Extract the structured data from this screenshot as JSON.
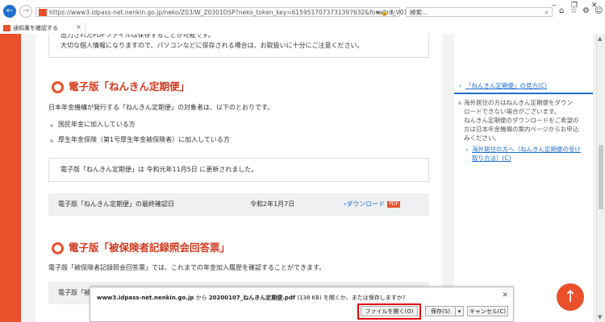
{
  "browser": {
    "url": "https://www3.idpass-net.nenkin.go.jp/neko/Z03/W_Z0301DSP?neko_token_key=6159517073731397632&forward_V0101",
    "url_host": "www3.idpass-net.nenkin.go.jp",
    "search_placeholder": "検索...",
    "tab_label": "通知書を確認する",
    "tab_close": "×"
  },
  "main": {
    "intro_line1": "出力されたPDFファイルは保存することが可能です。",
    "intro_line2": "大切な個人情報になりますので、パソコンなどに保存される場合は、お取扱いに十分にご注意ください。",
    "section1": {
      "title": "電子版「ねんきん定期便」",
      "desc": "日本年金機構が発行する「ねんきん定期便」の対象者は、以下のとおりです。",
      "bullets": [
        "国民年金に加入している方",
        "厚生年金保険（第1号厚生年金被保険者）に加入している方"
      ],
      "notice": "電子版「ねんきん定期便」は 令和元年11月5日 に更新されました。",
      "row_label": "電子版「ねんきん定期便」の最終確認日",
      "row_date": "令和2年1月7日",
      "download_label": "ダウンロード",
      "pdf_badge": "PDF"
    },
    "section2": {
      "title": "電子版「被保険者記録照会回答票」",
      "desc": "電子版「被保険者記録照会回答票」では、これまでの年金加入履歴を確認することができます。",
      "row_label": "電子版「被"
    }
  },
  "sidebar": {
    "link1": "「ねんきん定期便」の見方",
    "link1_suffix": "(C)",
    "note_lines": [
      "海外居住の方はねんきん定期便をダウン",
      "ロードできない場合がございます。",
      "ねんきん定期便のダウンロードをご希望の",
      "方は日本年金機構の案内ページからお申込",
      "みください。"
    ],
    "link2_line1": "海外居住の方へ（ねんきん定期便の受け",
    "link2_line2": "取り方法）",
    "link2_suffix": "(C)"
  },
  "download_bar": {
    "host": "www3.idpass-net.nenkin.go.jp",
    "message_mid": " から ",
    "file": "20200107_ねんきん定期便.pdf",
    "message_end": " (138 KB) を開くか、または保存しますか?",
    "open_label": "ファイルを開く(O)",
    "save_label": "保存(S)",
    "cancel_label": "キャンセル(C)"
  },
  "colors": {
    "accent": "#e9502b",
    "link": "#1f6fd0",
    "highlight": "#e00000"
  }
}
